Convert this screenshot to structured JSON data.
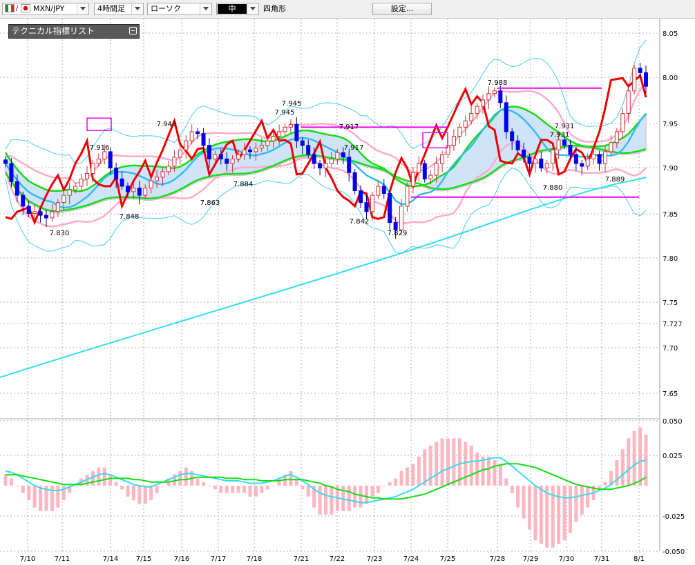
{
  "toolbar": {
    "symbol": "MXN/JPY",
    "timeframe": "4時間足",
    "chart_style": "ローソク",
    "line_width": "中",
    "shape": "四角形",
    "settings_button": "設定..."
  },
  "indicator_list": {
    "title": "テクニカル指標リスト"
  },
  "colors": {
    "up_candle": "#dd2222",
    "down_candle": "#0000ee",
    "ma_red": "#ee0000",
    "bollinger": "#44ccee",
    "ma_pink": "#ffaacc",
    "ma_green": "#11dd11",
    "ma_cyan": "#33bbee",
    "cloud": "#c8e0f8",
    "magenta": "#ee00ee",
    "macd_hist": "#ffb6c1"
  },
  "chart_data": [
    {
      "type": "candlestick",
      "timeframe": "4時間足",
      "y_ticks": [
        "8.05",
        "8.00",
        "7.95",
        "7.90",
        "7.85",
        "7.80",
        "7.75",
        "7.727",
        "7.70",
        "7.65"
      ],
      "ylim": [
        7.62,
        8.06
      ],
      "x_ticks": [
        "7/10",
        "7/11",
        "7/14",
        "7/15",
        "7/16",
        "7/17",
        "7/18",
        "7/21",
        "7/22",
        "7/23",
        "7/24",
        "7/25",
        "7/28",
        "7/29",
        "7/30",
        "7/31",
        "8/1"
      ],
      "price_labels": [
        {
          "text": "7.830",
          "x": 0,
          "y": 7.83
        },
        {
          "text": "7.916",
          "x": 0,
          "y": 7.916
        },
        {
          "text": "7.848",
          "x": 0,
          "y": 7.848
        },
        {
          "text": "7.943",
          "x": 0,
          "y": 7.943
        },
        {
          "text": "7.863",
          "x": 0,
          "y": 7.863
        },
        {
          "text": "7.884",
          "x": 0,
          "y": 7.884
        },
        {
          "text": "7.945",
          "x": 0,
          "y": 7.945
        },
        {
          "text": "7.945",
          "x": 0,
          "y": 7.945
        },
        {
          "text": "7.917",
          "x": 0,
          "y": 7.917
        },
        {
          "text": "7.917",
          "x": 0,
          "y": 7.917
        },
        {
          "text": "7.842",
          "x": 0,
          "y": 7.842
        },
        {
          "text": "7.829",
          "x": 0,
          "y": 7.829
        },
        {
          "text": "7.988",
          "x": 0,
          "y": 7.988
        },
        {
          "text": "7.931",
          "x": 0,
          "y": 7.931
        },
        {
          "text": "7.931",
          "x": 0,
          "y": 7.931
        },
        {
          "text": "7.880",
          "x": 0,
          "y": 7.88
        },
        {
          "text": "7.889",
          "x": 0,
          "y": 7.889
        }
      ],
      "horizontal_lines": [
        {
          "y": 7.945,
          "x_from": "7/21",
          "x_to": "7/25"
        },
        {
          "y": 7.988,
          "x_from": "7/28",
          "x_to": "7/31"
        },
        {
          "y": 7.868,
          "x_from": "7/24",
          "x_to": "8/1"
        }
      ],
      "candles_close": [
        7.905,
        7.885,
        7.87,
        7.858,
        7.85,
        7.852,
        7.848,
        7.845,
        7.852,
        7.862,
        7.87,
        7.876,
        7.88,
        7.888,
        7.894,
        7.905,
        7.91,
        7.918,
        7.9,
        7.888,
        7.88,
        7.874,
        7.878,
        7.87,
        7.878,
        7.886,
        7.89,
        7.896,
        7.902,
        7.912,
        7.92,
        7.93,
        7.94,
        7.938,
        7.925,
        7.91,
        7.915,
        7.91,
        7.905,
        7.91,
        7.915,
        7.92,
        7.918,
        7.922,
        7.925,
        7.93,
        7.935,
        7.94,
        7.945,
        7.948,
        7.93,
        7.925,
        7.915,
        7.905,
        7.9,
        7.905,
        7.91,
        7.917,
        7.912,
        7.895,
        7.875,
        7.862,
        7.852,
        7.87,
        7.88,
        7.872,
        7.84,
        7.832,
        7.858,
        7.88,
        7.895,
        7.905,
        7.888,
        7.892,
        7.905,
        7.915,
        7.925,
        7.935,
        7.945,
        7.952,
        7.96,
        7.968,
        7.975,
        7.982,
        7.985,
        7.972,
        7.94,
        7.93,
        7.92,
        7.912,
        7.905,
        7.91,
        7.9,
        7.905,
        7.92,
        7.931,
        7.925,
        7.915,
        7.905,
        7.902,
        7.91,
        7.915,
        7.905,
        7.918,
        7.928,
        7.94,
        7.96,
        7.985,
        8.01,
        8.005,
        7.99
      ]
    },
    {
      "type": "macd",
      "y_ticks": [
        "0.050",
        "0.025",
        "-0.025",
        "-0.050"
      ],
      "ylim": [
        -0.05,
        0.05
      ],
      "series": [
        {
          "values": [
            0.012,
            0.011,
            0.009,
            0.006,
            0.003,
            0.0,
            -0.002,
            -0.003,
            -0.004,
            -0.004,
            -0.003,
            -0.001,
            0.001,
            0.003,
            0.005,
            0.007,
            0.009,
            0.01,
            0.009,
            0.007,
            0.005,
            0.003,
            0.001,
            0.0,
            -0.001,
            -0.001,
            0.001,
            0.003,
            0.005,
            0.007,
            0.009,
            0.01,
            0.01,
            0.009,
            0.008,
            0.007,
            0.006,
            0.005,
            0.004,
            0.004,
            0.004,
            0.003,
            0.002,
            0.002,
            0.002,
            0.003,
            0.004,
            0.006,
            0.008,
            0.009,
            0.007,
            0.004,
            0.001,
            -0.003,
            -0.006,
            -0.008,
            -0.009,
            -0.01,
            -0.011,
            -0.012,
            -0.013,
            -0.014,
            -0.014,
            -0.013,
            -0.012,
            -0.011,
            -0.01,
            -0.009,
            -0.007,
            -0.005,
            -0.003,
            0.0,
            0.003,
            0.006,
            0.009,
            0.012,
            0.014,
            0.016,
            0.018,
            0.019,
            0.02,
            0.02,
            0.021,
            0.022,
            0.023,
            0.023,
            0.02,
            0.016,
            0.012,
            0.008,
            0.004,
            0.0,
            -0.003,
            -0.006,
            -0.008,
            -0.009,
            -0.01,
            -0.01,
            -0.009,
            -0.008,
            -0.007,
            -0.006,
            -0.004,
            -0.002,
            0.001,
            0.005,
            0.009,
            0.013,
            0.017,
            0.02,
            0.021
          ]
        },
        {
          "values": [
            0.009,
            0.009,
            0.009,
            0.008,
            0.007,
            0.006,
            0.005,
            0.004,
            0.003,
            0.002,
            0.001,
            0.001,
            0.001,
            0.001,
            0.002,
            0.003,
            0.004,
            0.005,
            0.006,
            0.006,
            0.006,
            0.006,
            0.005,
            0.005,
            0.004,
            0.003,
            0.003,
            0.003,
            0.003,
            0.004,
            0.005,
            0.005,
            0.006,
            0.007,
            0.007,
            0.007,
            0.007,
            0.007,
            0.006,
            0.006,
            0.006,
            0.005,
            0.005,
            0.005,
            0.004,
            0.004,
            0.004,
            0.004,
            0.005,
            0.005,
            0.005,
            0.005,
            0.004,
            0.003,
            0.002,
            0.0,
            -0.001,
            -0.003,
            -0.004,
            -0.005,
            -0.007,
            -0.008,
            -0.009,
            -0.01,
            -0.01,
            -0.011,
            -0.011,
            -0.011,
            -0.011,
            -0.01,
            -0.009,
            -0.008,
            -0.007,
            -0.005,
            -0.003,
            -0.001,
            0.001,
            0.003,
            0.005,
            0.007,
            0.009,
            0.011,
            0.013,
            0.014,
            0.016,
            0.017,
            0.018,
            0.018,
            0.018,
            0.017,
            0.016,
            0.015,
            0.013,
            0.011,
            0.009,
            0.007,
            0.005,
            0.003,
            0.001,
            0.0,
            -0.001,
            -0.002,
            -0.003,
            -0.003,
            -0.003,
            -0.002,
            -0.001,
            0.0,
            0.002,
            0.004,
            0.007
          ]
        }
      ]
    }
  ]
}
